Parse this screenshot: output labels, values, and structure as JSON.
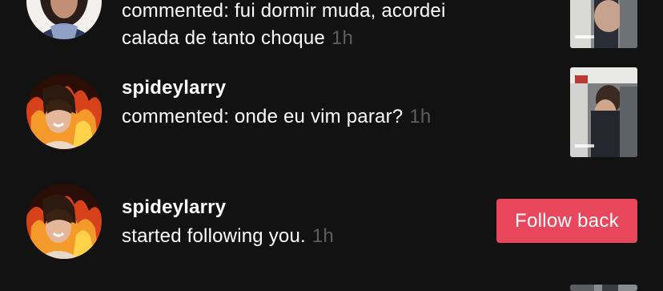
{
  "notifications": [
    {
      "message_line1": "commented: fui dormir muda, acordei",
      "message_line2": "calada de tanto choque",
      "time": "1h",
      "thumbnail": "video-thumbnail"
    },
    {
      "username": "spideylarry",
      "message": "commented: onde eu vim parar?",
      "time": "1h",
      "thumbnail": "video-thumbnail"
    },
    {
      "username": "spideylarry",
      "message": "started following you.",
      "time": "1h",
      "action_label": "Follow back"
    }
  ],
  "colors": {
    "background": "#121212",
    "text": "#ffffff",
    "timestamp": "#5e5e5e",
    "follow_button": "#e9475b"
  }
}
